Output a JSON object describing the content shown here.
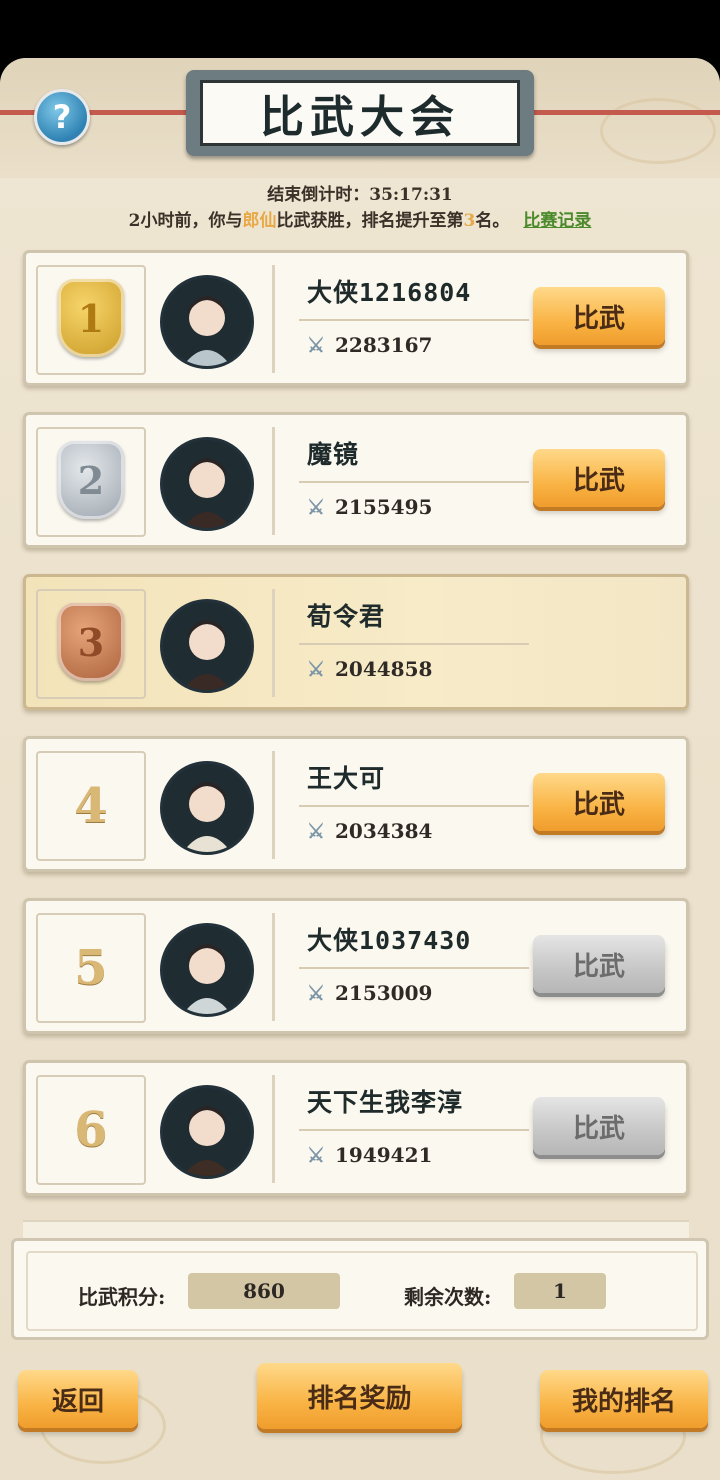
{
  "colors": {
    "accent_orange": "#f9b445",
    "highlight_name": "#e7a845",
    "link_green": "#4b8a2a",
    "help_blue": "#2f82b3"
  },
  "header": {
    "title": "比武大会",
    "help_icon": "question-mark-icon",
    "countdown": "结束倒计时：35:17:31",
    "notice": {
      "prefix": "2小时前，你与",
      "opponent": "郎仙",
      "middle": "比武获胜，排名提升至第",
      "rank": "3",
      "suffix": "名。",
      "record_link": "比赛记录"
    }
  },
  "players": [
    {
      "rank": "1",
      "name": "大侠1216804",
      "power": "2283167",
      "button": "比武",
      "button_enabled": true,
      "highlight": false,
      "badge": "gold"
    },
    {
      "rank": "2",
      "name": "魔镜",
      "power": "2155495",
      "button": "比武",
      "button_enabled": true,
      "highlight": false,
      "badge": "silver"
    },
    {
      "rank": "3",
      "name": "荀令君",
      "power": "2044858",
      "button": "",
      "button_enabled": false,
      "highlight": true,
      "badge": "bronze"
    },
    {
      "rank": "4",
      "name": "王大可",
      "power": "2034384",
      "button": "比武",
      "button_enabled": true,
      "highlight": false,
      "badge": "none"
    },
    {
      "rank": "5",
      "name": "大侠1037430",
      "power": "2153009",
      "button": "比武",
      "button_enabled": false,
      "highlight": false,
      "badge": "none"
    },
    {
      "rank": "6",
      "name": "天下生我李淳",
      "power": "1949421",
      "button": "比武",
      "button_enabled": false,
      "highlight": false,
      "badge": "none"
    }
  ],
  "stats": {
    "score_label": "比武积分:",
    "score_value": "860",
    "remaining_label": "剩余次数:",
    "remaining_value": "1"
  },
  "buttons": {
    "back": "返回",
    "rank_reward": "排名奖励",
    "my_rank": "我的排名"
  }
}
